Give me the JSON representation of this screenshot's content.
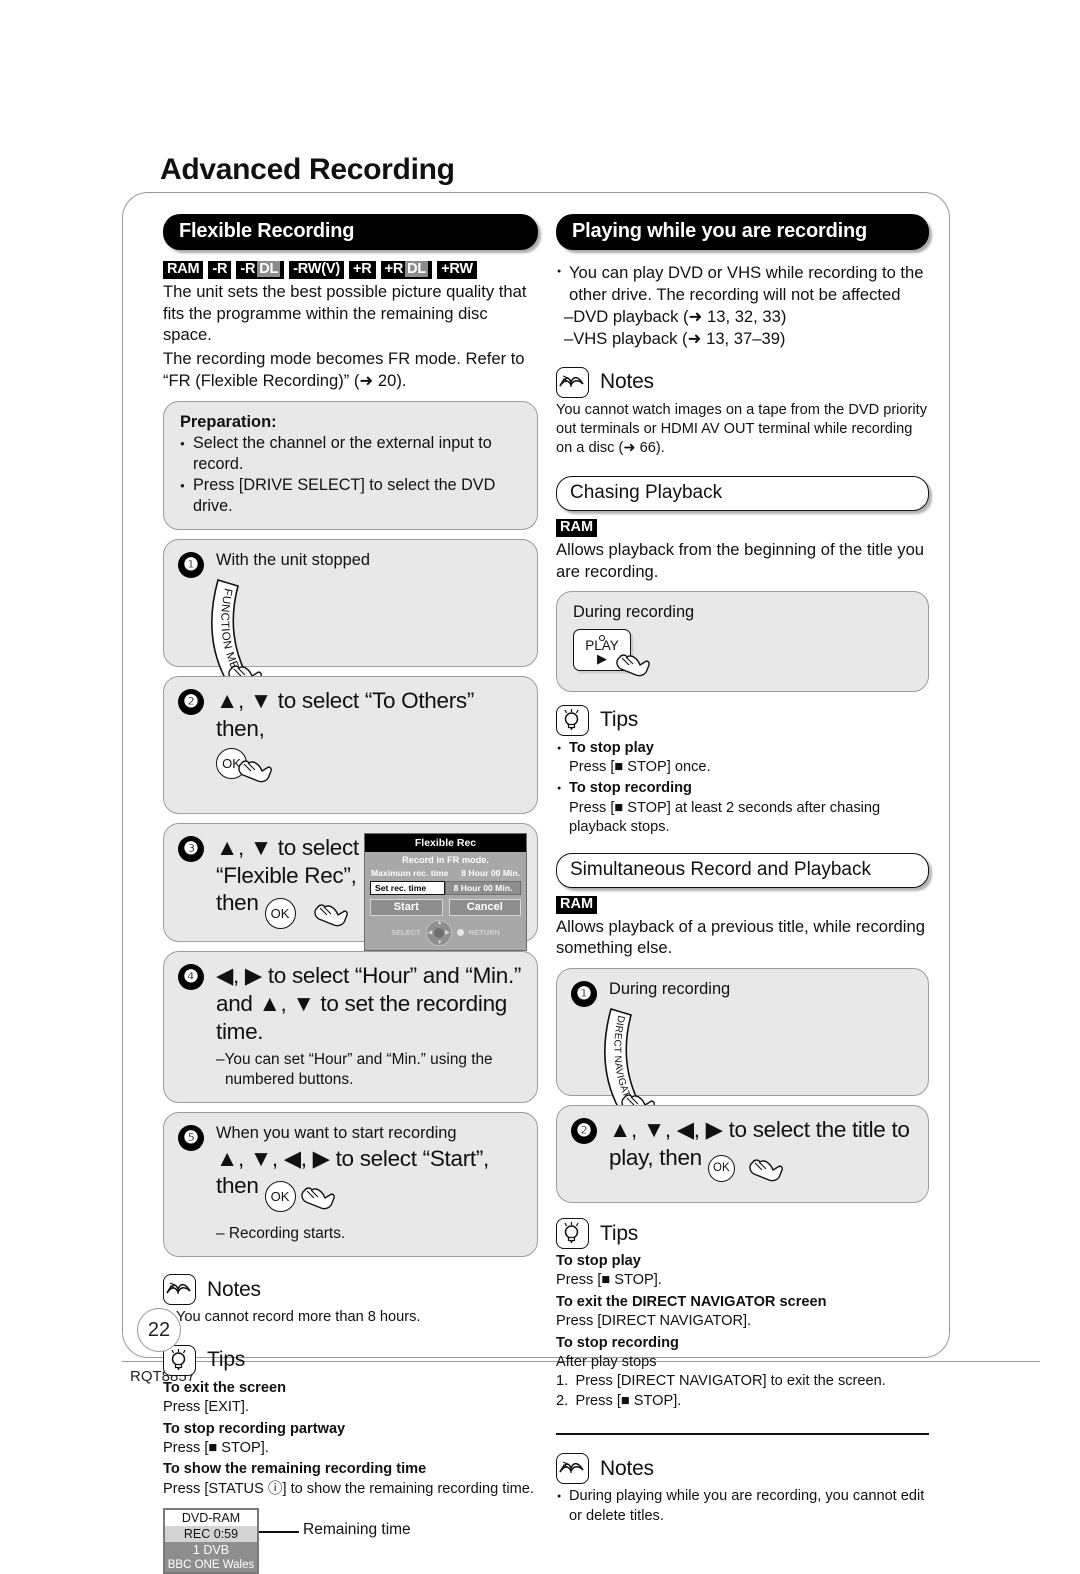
{
  "page": {
    "title": "Advanced Recording",
    "number": "22",
    "footer_code": "RQT8857"
  },
  "left": {
    "section_title": "Flexible Recording",
    "badges": [
      {
        "label": "RAM"
      },
      {
        "label": "-R"
      },
      {
        "label": "-R",
        "dl": "DL"
      },
      {
        "label": "-RW(V)"
      },
      {
        "label": "+R"
      },
      {
        "label": "+R",
        "dl": "DL"
      },
      {
        "label": "+RW"
      }
    ],
    "intro_1": "The unit sets the best possible picture quality that fits the programme within the remaining disc space.",
    "intro_2": "The recording mode becomes FR mode. Refer to “FR (Flexible Recording)” (➜ 20).",
    "preparation": {
      "title": "Preparation:",
      "items": [
        "Select the channel or the external input to record.",
        "Press [DRIVE SELECT] to select the DVD drive."
      ]
    },
    "steps": [
      {
        "num": "❶",
        "lead": "With the unit stopped",
        "button_label": "FUNCTION MENU"
      },
      {
        "num": "❷",
        "big": "▲, ▼ to select “To Others” then,",
        "key": "OK"
      },
      {
        "num": "❸",
        "big_lines": [
          "▲, ▼ to select",
          "“Flexible Rec”,",
          "then"
        ],
        "key": "OK",
        "osd": {
          "title": "Flexible Rec",
          "subtitle": "Record in FR mode.",
          "max_label": "Maximum rec. time",
          "max_value": "8 Hour 00 Min.",
          "set_label": "Set rec. time",
          "set_value": "8 Hour 00 Min.",
          "start": "Start",
          "cancel": "Cancel",
          "select": "SELECT",
          "return": "RETURN"
        }
      },
      {
        "num": "❹",
        "big_lines": [
          "◀, ▶ to select “Hour” and “Min.”",
          "and ▲, ▼ to set the recording time."
        ],
        "dash": "–You can set “Hour” and “Min.” using the numbered buttons."
      },
      {
        "num": "❺",
        "lead": "When you want to start recording",
        "big_lines": [
          "▲, ▼, ◀, ▶ to select “Start”,",
          "then"
        ],
        "key": "OK",
        "dash": "– Recording starts."
      }
    ],
    "notes": {
      "label": "Notes",
      "items": [
        "You cannot record more than 8 hours."
      ]
    },
    "tips": {
      "label": "Tips",
      "entries": [
        {
          "title": "To exit the screen",
          "desc": "Press [EXIT]."
        },
        {
          "title": "To stop recording partway",
          "desc": "Press [■ STOP]."
        },
        {
          "title": "To show the remaining recording time",
          "desc": "Press [STATUS ⓘ] to show the remaining recording time."
        }
      ]
    },
    "status_display": {
      "line1": "DVD-RAM",
      "line2": "REC 0:59",
      "line3": "1 DVB",
      "line4": "BBC ONE Wales",
      "callout": "Remaining time"
    }
  },
  "right": {
    "section_title": "Playing while you are recording",
    "intro_bullet": "You can play DVD or VHS while recording to the other drive. The recording will not be affected",
    "intro_dashes": [
      "–DVD playback (➜ 13, 32, 33)",
      "–VHS playback (➜ 13, 37–39)"
    ],
    "notes_top": {
      "label": "Notes",
      "text": "You cannot watch images on a tape from the DVD priority out terminals or HDMI AV OUT terminal while recording on a disc (➜ 66)."
    },
    "chasing": {
      "heading": "Chasing Playback",
      "badge": "RAM",
      "desc": "Allows playback from the beginning of the title you are recording.",
      "box_lead": "During recording",
      "play_label": "PLAY",
      "tips": {
        "label": "Tips",
        "entries": [
          {
            "title": "To stop play",
            "desc": "Press [■ STOP] once."
          },
          {
            "title": "To stop recording",
            "desc": "Press [■ STOP] at least 2 seconds after chasing playback stops."
          }
        ]
      }
    },
    "simultaneous": {
      "heading": "Simultaneous Record and Playback",
      "badge": "RAM",
      "desc": "Allows playback of a previous title, while recording something else.",
      "steps": [
        {
          "num": "❶",
          "lead": "During recording",
          "button_label": "DIRECT NAVIGATOR"
        },
        {
          "num": "❷",
          "big_lines": [
            "▲, ▼, ◀, ▶ to select the title to",
            "play, then"
          ],
          "key": "OK"
        }
      ],
      "tips": {
        "label": "Tips",
        "entries": [
          {
            "title": "To stop play",
            "desc": "Press [■ STOP]."
          },
          {
            "title": "To exit the DIRECT NAVIGATOR screen",
            "desc": "Press [DIRECT NAVIGATOR]."
          },
          {
            "title": "To stop recording",
            "desc": "After play stops"
          }
        ],
        "numbered": [
          "1. Press [DIRECT NAVIGATOR] to exit the screen.",
          "2. Press [■ STOP]."
        ]
      }
    },
    "notes_bottom": {
      "label": "Notes",
      "items": [
        "During playing while you are recording, you cannot edit or delete titles."
      ]
    }
  }
}
